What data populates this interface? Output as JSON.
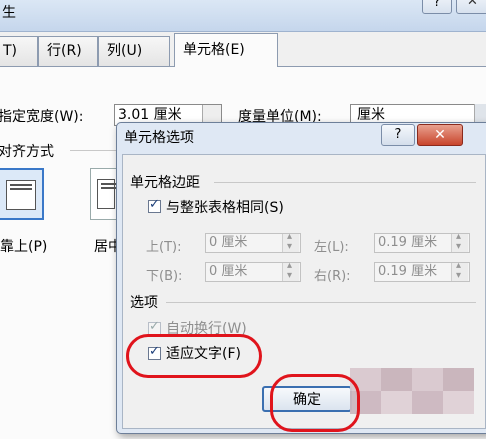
{
  "bg_window": {
    "title_fragment": "生",
    "help_glyph": "?",
    "tabs": [
      {
        "label": "T)"
      },
      {
        "label": "行(R)"
      },
      {
        "label": "列(U)"
      },
      {
        "label": "单元格(E)"
      }
    ],
    "width_label": "指定宽度(W):",
    "width_value": "3.01 厘米",
    "unit_label": "度量单位(M):",
    "unit_value": "厘米",
    "align_section": "对齐方式",
    "align_top_label": "靠上(P)",
    "align_mid_label": "居中"
  },
  "dialog": {
    "title": "单元格选项",
    "help_glyph": "?",
    "close_glyph": "✕",
    "margins_group": "单元格边距",
    "same_as_table": "与整张表格相同(S)",
    "top_label": "上(T):",
    "top_value": "0 厘米",
    "left_label": "左(L):",
    "left_value": "0.19 厘米",
    "bottom_label": "下(B):",
    "bottom_value": "0 厘米",
    "right_label": "右(R):",
    "right_value": "0.19 厘米",
    "options_group": "选项",
    "wrap_text": "自动换行(W)",
    "fit_text": "适应文字(F)",
    "ok_button": "确定"
  },
  "colors": {
    "highlight": "#e0141c",
    "dialog_frame": "#dfe8f4",
    "close_button": "#c8452c"
  }
}
